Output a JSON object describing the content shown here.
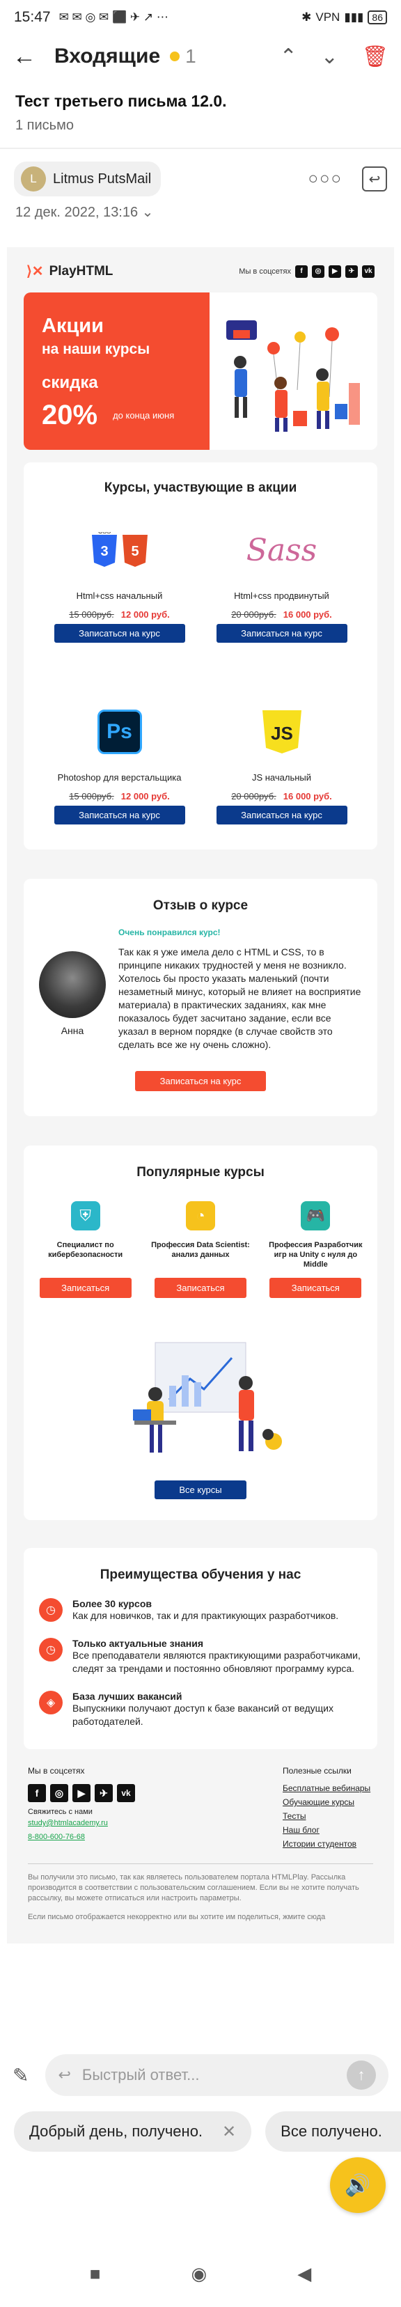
{
  "status": {
    "time": "15:47",
    "battery": "86"
  },
  "appbar": {
    "title": "Входящие",
    "count": "1"
  },
  "subject": "Тест третьего письма 12.0.",
  "message_count": "1 письмо",
  "sender": {
    "initial": "L",
    "name": "Litmus PutsMail",
    "date": "12 дек. 2022, 13:16"
  },
  "mail": {
    "logo": "PlayHTML",
    "social_label": "Мы в соцсетях",
    "banner": {
      "h1": "Акции",
      "h2": "на наши курсы",
      "skidka": "скидка",
      "percent": "20%",
      "until": "до конца июня"
    },
    "courses_title": "Курсы, участвующие в акции",
    "courses": [
      {
        "name": "Html+css начальный",
        "old": "15 000руб.",
        "new": "12 000 руб.",
        "btn": "Записаться на курс"
      },
      {
        "name": "Html+css продвинутый",
        "old": "20 000руб.",
        "new": "16 000 руб.",
        "btn": "Записаться на курс"
      },
      {
        "name": "Photoshop для верстальщика",
        "old": "15 000руб.",
        "new": "12 000 руб.",
        "btn": "Записаться на курс"
      },
      {
        "name": "JS начальный",
        "old": "20 000руб.",
        "new": "16 000 руб.",
        "btn": "Записаться на курс"
      }
    ],
    "review": {
      "title": "Отзыв о курсе",
      "liked": "Очень понравился курс!",
      "text": "Так как я уже имела дело с HTML и CSS, то в принципе никаких трудностей у меня не возникло. Хотелось бы просто указать маленький (почти незаметный минус, который не влияет на восприятие материала) в практических заданиях, как мне показалось будет засчитано задание, если все указал в верном порядке (в случае свойств это сделать все же ну очень сложно).",
      "name": "Анна",
      "btn": "Записаться на курс"
    },
    "popular": {
      "title": "Популярные курсы",
      "items": [
        {
          "label": "Специалист по кибербезопасности",
          "btn": "Записаться"
        },
        {
          "label": "Профессия Data Scientist: анализ данных",
          "btn": "Записаться"
        },
        {
          "label": "Профессия Разработчик игр на Unity с нуля до Middle",
          "btn": "Записаться"
        }
      ],
      "all_btn": "Все курсы"
    },
    "advantages": {
      "title": "Преимущества обучения у нас",
      "items": [
        {
          "head": "Более 30 курсов",
          "text": "Как для новичков, так и для практикующих разработчиков."
        },
        {
          "head": "Только актуальные знания",
          "text": "Все преподаватели являются практикующими разработчиками, следят за трендами и постоянно обновляют программу курса."
        },
        {
          "head": "База лучших вакансий",
          "text": "Выпускники получают доступ к базе вакансий от ведущих работодателей."
        }
      ]
    },
    "footer": {
      "social": "Мы в соцсетях",
      "contact": "Свяжитесь с нами",
      "email": "study@htmlacademy.ru",
      "phone": "8-800-600-76-68",
      "links_title": "Полезные ссылки",
      "links": [
        "Бесплатные вебинары",
        "Обучающие курсы",
        "Тесты",
        "Наш блог",
        "Истории студентов"
      ],
      "legal": "Вы получили это письмо, так как являетесь пользователем портала HTMLPlay. Рассылка производится в соответствии с пользовательским соглашением. Если вы не хотите получать рассылку, вы можете отписаться или настроить параметры.",
      "share": "Если письмо отображается некорректно или вы хотите им поделиться, жмите сюда"
    }
  },
  "composer": {
    "placeholder": "Быстрый ответ..."
  },
  "quick_replies": [
    "Добрый день, получено.",
    "Все получено."
  ]
}
